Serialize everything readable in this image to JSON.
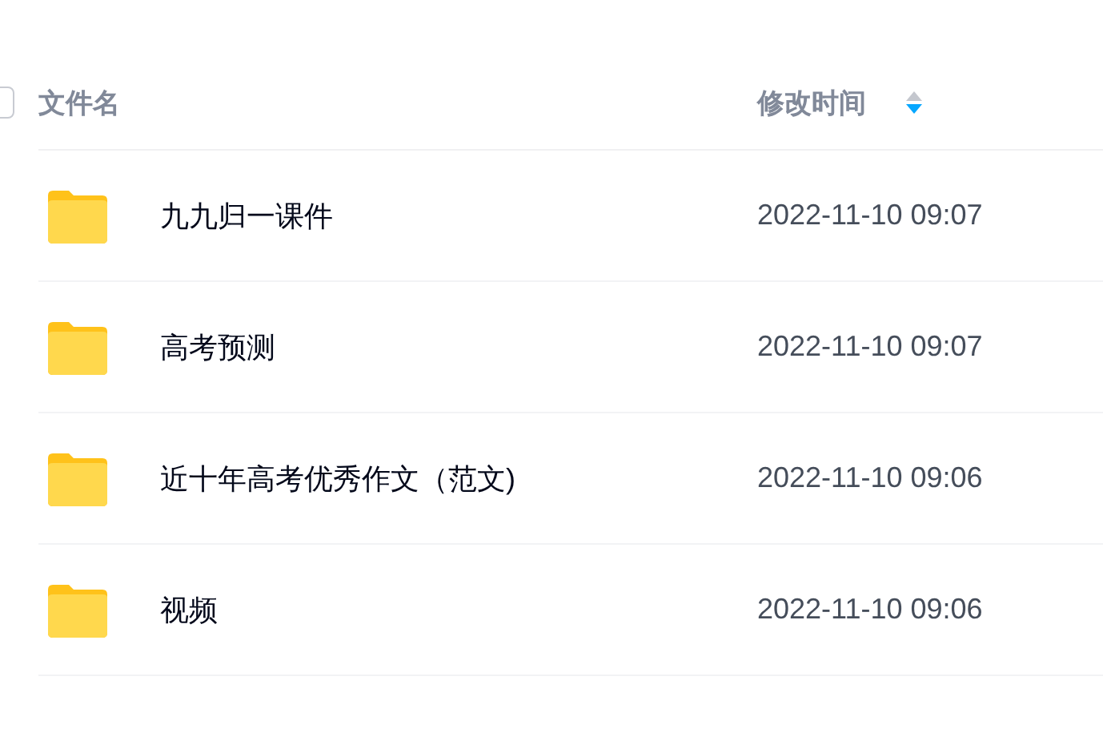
{
  "table": {
    "select_all": {
      "checked": false
    },
    "columns": [
      {
        "label": "文件名"
      },
      {
        "label": "修改时间",
        "sort_descending": true
      }
    ],
    "rows": [
      {
        "name": "九九归一课件",
        "modified": "2022-11-10 09:07"
      },
      {
        "name": "高考预测",
        "modified": "2022-11-10 09:07"
      },
      {
        "name": "近十年高考优秀作文（范文)",
        "modified": "2022-11-10 09:06"
      },
      {
        "name": "视频",
        "modified": "2022-11-10 09:06"
      }
    ]
  }
}
